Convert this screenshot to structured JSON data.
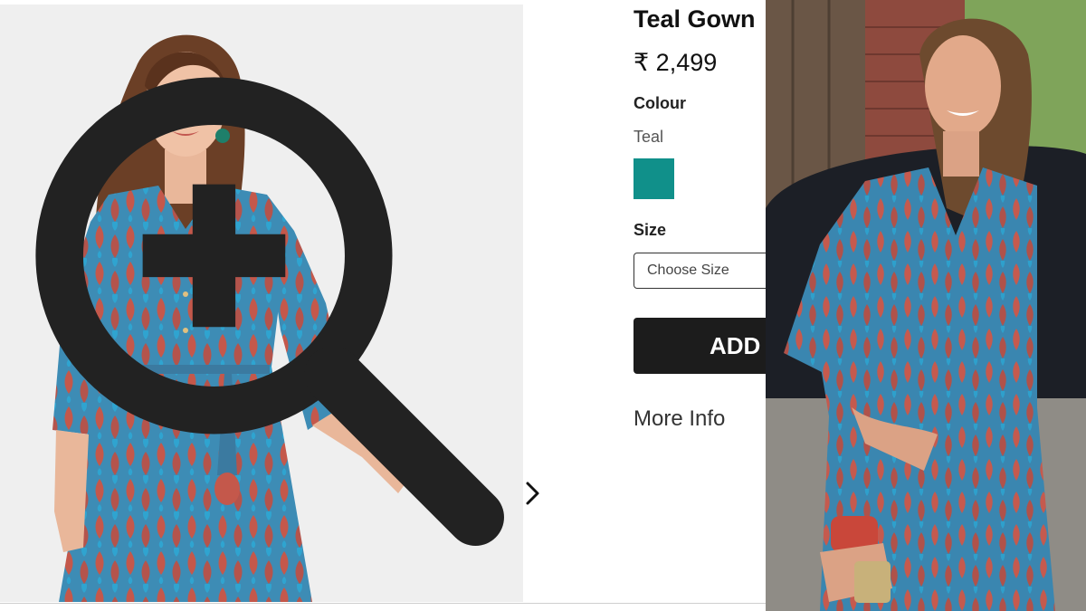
{
  "product": {
    "title": "Teal Gown",
    "price": "₹ 2,499",
    "colour_label": "Colour",
    "colour_value": "Teal",
    "swatch_color": "#10908a",
    "size_label": "Size",
    "size_placeholder": "Choose Size",
    "add_button_label": "ADD",
    "more_info_label": "More Info"
  },
  "icons": {
    "zoom": "zoom-in-icon",
    "next": "chevron-right-icon"
  },
  "colors": {
    "dress_blue": "#3a8fb8",
    "dress_red": "#c65a4e",
    "button_dark": "#1c1c1c"
  }
}
